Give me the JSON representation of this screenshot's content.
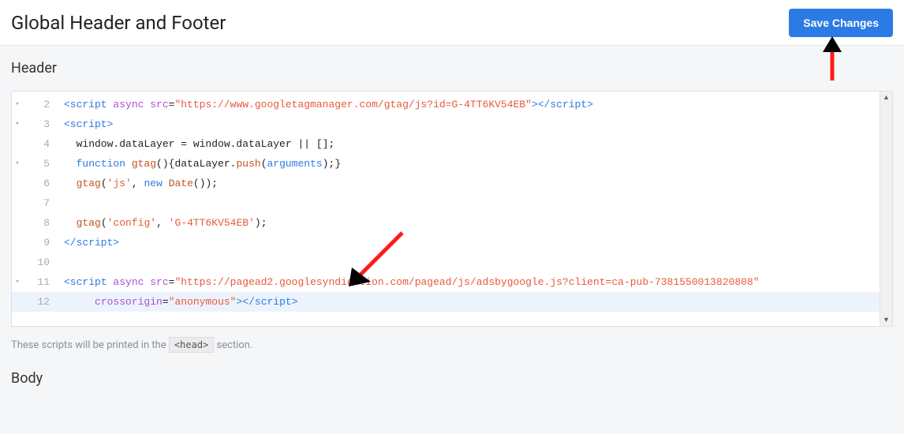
{
  "page_title": "Global Header and Footer",
  "save_label": "Save Changes",
  "sections": {
    "header": {
      "title": "Header"
    },
    "body": {
      "title": "Body"
    }
  },
  "hint_prefix": "These scripts will be printed in the ",
  "hint_tag": "<head>",
  "hint_suffix": " section.",
  "editor": {
    "lines": [
      {
        "n": 2,
        "fold": "▾",
        "tokens": [
          {
            "c": "tag",
            "t": "<script "
          },
          {
            "c": "attr",
            "t": "async "
          },
          {
            "c": "attr",
            "t": "src"
          },
          {
            "c": "op",
            "t": "="
          },
          {
            "c": "str",
            "t": "\"https://www.googletagmanager.com/gtag/js?id=G-4TT6KV54EB\""
          },
          {
            "c": "tag",
            "t": ">"
          },
          {
            "c": "tag",
            "t": "</script>"
          }
        ]
      },
      {
        "n": 3,
        "fold": "▾",
        "tokens": [
          {
            "c": "tag",
            "t": "<script>"
          }
        ]
      },
      {
        "n": 4,
        "fold": "",
        "tokens": [
          {
            "c": "txt",
            "t": "  window.dataLayer = window.dataLayer || [];"
          }
        ]
      },
      {
        "n": 5,
        "fold": "▾",
        "tokens": [
          {
            "c": "txt",
            "t": "  "
          },
          {
            "c": "kw",
            "t": "function "
          },
          {
            "c": "fn",
            "t": "gtag"
          },
          {
            "c": "txt",
            "t": "(){dataLayer."
          },
          {
            "c": "fn",
            "t": "push"
          },
          {
            "c": "txt",
            "t": "("
          },
          {
            "c": "arg",
            "t": "arguments"
          },
          {
            "c": "txt",
            "t": ");}"
          }
        ]
      },
      {
        "n": 6,
        "fold": "",
        "tokens": [
          {
            "c": "txt",
            "t": "  "
          },
          {
            "c": "fn",
            "t": "gtag"
          },
          {
            "c": "txt",
            "t": "("
          },
          {
            "c": "str",
            "t": "'js'"
          },
          {
            "c": "txt",
            "t": ", "
          },
          {
            "c": "kw",
            "t": "new "
          },
          {
            "c": "fn",
            "t": "Date"
          },
          {
            "c": "txt",
            "t": "());"
          }
        ]
      },
      {
        "n": 7,
        "fold": "",
        "tokens": [
          {
            "c": "txt",
            "t": ""
          }
        ]
      },
      {
        "n": 8,
        "fold": "",
        "tokens": [
          {
            "c": "txt",
            "t": "  "
          },
          {
            "c": "fn",
            "t": "gtag"
          },
          {
            "c": "txt",
            "t": "("
          },
          {
            "c": "str",
            "t": "'config'"
          },
          {
            "c": "txt",
            "t": ", "
          },
          {
            "c": "str",
            "t": "'G-4TT6KV54EB'"
          },
          {
            "c": "txt",
            "t": ");"
          }
        ]
      },
      {
        "n": 9,
        "fold": "",
        "tokens": [
          {
            "c": "tag",
            "t": "</script>"
          }
        ]
      },
      {
        "n": 10,
        "fold": "",
        "tokens": [
          {
            "c": "txt",
            "t": ""
          }
        ]
      },
      {
        "n": 11,
        "fold": "▾",
        "tokens": [
          {
            "c": "tag",
            "t": "<script "
          },
          {
            "c": "attr",
            "t": "async "
          },
          {
            "c": "attr",
            "t": "src"
          },
          {
            "c": "op",
            "t": "="
          },
          {
            "c": "str",
            "t": "\"https://pagead2.googlesyndication.com/pagead/js/adsbygoogle.js?client=ca-pub-7381550013820808\""
          }
        ]
      },
      {
        "n": 12,
        "fold": "",
        "hl": true,
        "tokens": [
          {
            "c": "txt",
            "t": "     "
          },
          {
            "c": "attr",
            "t": "crossorigin"
          },
          {
            "c": "op",
            "t": "="
          },
          {
            "c": "str",
            "t": "\"anonymous\""
          },
          {
            "c": "tag",
            "t": ">"
          },
          {
            "c": "tag",
            "t": "</script>"
          }
        ]
      }
    ]
  }
}
